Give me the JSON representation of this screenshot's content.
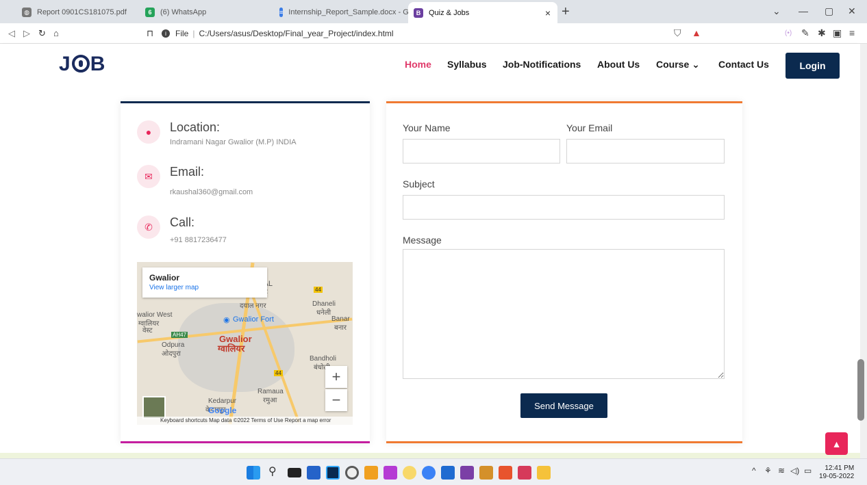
{
  "browser": {
    "tabs": [
      {
        "title": "Report 0901CS181075.pdf",
        "icon": "globe-icon"
      },
      {
        "title": "(6) WhatsApp",
        "icon": "whatsapp-icon"
      },
      {
        "title": "Internship_Report_Sample.docx - Goo",
        "icon": "docs-icon"
      },
      {
        "title": "Quiz & Jobs",
        "icon": "bootstrap-icon",
        "active": true
      }
    ],
    "new_tab": "+",
    "close_tab": "×",
    "address_prefix": "File",
    "address_path": "C:/Users/asus/Desktop/Final_year_Project/index.html"
  },
  "site": {
    "logo_left": "J",
    "logo_right": "B",
    "nav": [
      "Home",
      "Syllabus",
      "Job-Notifications",
      "About Us",
      "Course ⌄",
      "Contact Us"
    ],
    "login": "Login"
  },
  "contact_info": {
    "location_title": "Location:",
    "location_value": "Indramani Nagar Gwalior (M.P) INDIA",
    "email_title": "Email:",
    "email_value": "rkaushal360@gmail.com",
    "call_title": "Call:",
    "call_value": "+91 8817236477"
  },
  "map": {
    "popup_title": "Gwalior",
    "popup_link": "View larger map",
    "labels": {
      "yal": "YAL",
      "r": "R",
      "dayal_nagar": "दयाल नगर",
      "dhaneli": "Dhaneli",
      "dhaneli_hi": "धनेली",
      "banar": "Banar",
      "banar_hi": "बनार",
      "gwalior_west": "walior West",
      "gwalior_west_hi": "ग्वालियर",
      "west_hi": "वेस्ट",
      "fort": "Gwalior Fort",
      "ah47": "AH47",
      "odpura": "Odpura",
      "odpura_hi": "ओदपुरा",
      "gwalior": "Gwalior",
      "gwalior_hi": "ग्वालियर",
      "bandholi": "Bandholi",
      "bandholi_hi": "बंधोली",
      "ramaua": "Ramaua",
      "ramaua_hi": "रमुआ",
      "kedarpur": "Kedarpur",
      "kedarpur_hi": "केदारपुर",
      "road44": "44"
    },
    "google": "Google",
    "zoom_in": "+",
    "zoom_out": "−",
    "footer": "Keyboard shortcuts   Map data ©2022   Terms of Use   Report a map error"
  },
  "form": {
    "name_label": "Your Name",
    "email_label": "Your Email",
    "subject_label": "Subject",
    "message_label": "Message",
    "send": "Send Message"
  },
  "taskbar": {
    "time": "12:41 PM",
    "date": "19-05-2022"
  },
  "colors": {
    "brand_navy": "#0b2a4f",
    "accent_pink": "#e8265a",
    "accent_orange": "#f07a32",
    "accent_magenta": "#c41d9f"
  }
}
